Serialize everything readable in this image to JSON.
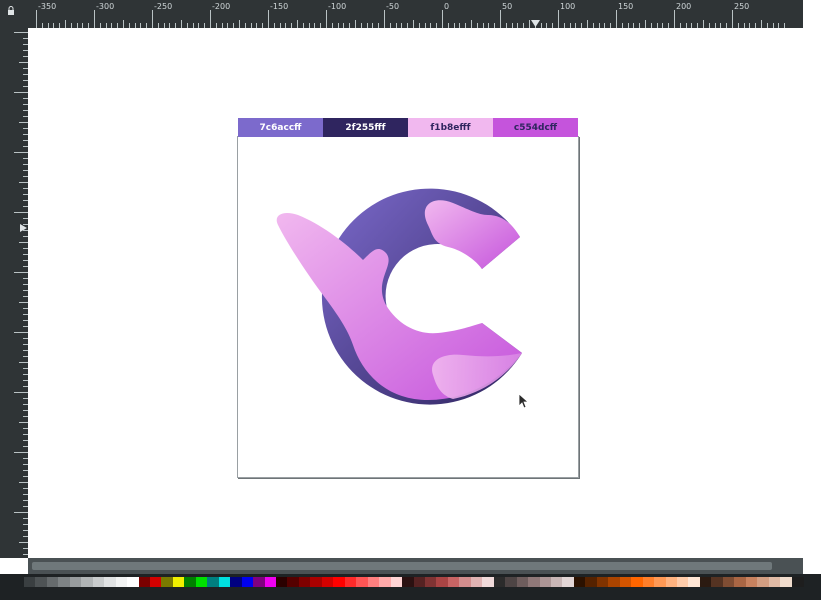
{
  "ruler": {
    "labels": [
      "-350",
      "-300",
      "-250",
      "-200",
      "-150",
      "-100",
      "-50",
      "0",
      "50",
      "100",
      "150",
      "200",
      "250"
    ]
  },
  "swatches": [
    {
      "label": "7c6accff",
      "bg": "#7c6acc",
      "fg": "#ffffff"
    },
    {
      "label": "2f255fff",
      "bg": "#2f255f",
      "fg": "#ffffff"
    },
    {
      "label": "f1b8efff",
      "bg": "#f1b8ef",
      "fg": "#2f255f"
    },
    {
      "label": "c554dcff",
      "bg": "#c554dc",
      "fg": "#2f255f"
    }
  ],
  "logo": {
    "name": "C gradient logo",
    "colors": [
      "#7c6acc",
      "#2f255f",
      "#f1b8ef",
      "#c554dc"
    ]
  },
  "palette": {
    "colors": [
      "#3a3f41",
      "#4e5355",
      "#666b6d",
      "#7e8385",
      "#989c9e",
      "#b1b5b6",
      "#c9cccd",
      "#e0e2e3",
      "#f2f3f3",
      "#ffffff",
      "#7a0000",
      "#d40000",
      "#7a7a00",
      "#f0f000",
      "#008000",
      "#00e000",
      "#008080",
      "#00e0e0",
      "#000080",
      "#0000f0",
      "#800080",
      "#f000f0",
      "#2a0000",
      "#550000",
      "#7f0000",
      "#aa0000",
      "#d40000",
      "#ff0000",
      "#ff2a2a",
      "#ff5555",
      "#ff8080",
      "#ffaaaa",
      "#ffd5d5",
      "#2b1111",
      "#552222",
      "#803333",
      "#aa4444",
      "#c86464",
      "#d38d8d",
      "#e0b3b3",
      "#f0dada",
      "#2b2b2b",
      "#4d4444",
      "#6e5d5d",
      "#8f7878",
      "#ad9696",
      "#c9b6b6",
      "#e3d6d6",
      "#2b1100",
      "#552200",
      "#803300",
      "#aa4400",
      "#d45500",
      "#ff6600",
      "#ff7f2a",
      "#ff9955",
      "#ffb380",
      "#ffccaa",
      "#ffe6d5",
      "#2b1a11",
      "#553322",
      "#804d33",
      "#aa6644",
      "#c8825f",
      "#d39e82",
      "#e0baa5",
      "#f0dccd",
      "#1e1e1e"
    ]
  }
}
